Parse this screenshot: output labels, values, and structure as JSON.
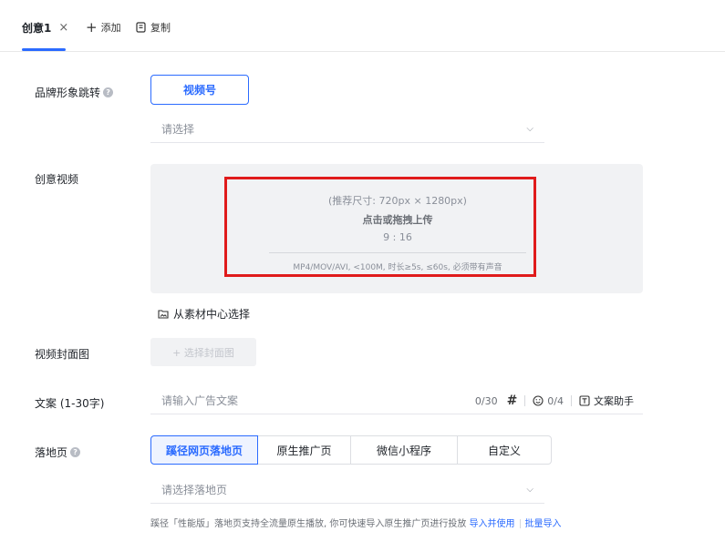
{
  "tabs": {
    "active_label": "创意1",
    "close_glyph": "×",
    "add_label": "添加",
    "copy_label": "复制"
  },
  "brand": {
    "label": "品牌形象跳转",
    "button": "视频号",
    "select_placeholder": "请选择"
  },
  "video": {
    "label": "创意视频",
    "size_hint": "(推荐尺寸: 720px × 1280px)",
    "click_hint": "点击或拖拽上传",
    "ratio": "9 : 16",
    "spec": "MP4/MOV/AVI, <100M, 时长≥5s, ≤60s, 必须带有声音",
    "material_link": "从素材中心选择"
  },
  "cover": {
    "label": "视频封面图",
    "button": "+ 选择封面图"
  },
  "copy": {
    "label": "文案 (1-30字)",
    "placeholder": "请输入广告文案",
    "count": "0/30",
    "hash": "#",
    "emoji_count": "0/4",
    "assistant": "文案助手"
  },
  "landing": {
    "label": "落地页",
    "segments": [
      "蹊径网页落地页",
      "原生推广页",
      "微信小程序",
      "自定义"
    ],
    "select_placeholder": "请选择落地页",
    "hint": "蹊径「性能版」落地页支持全流量原生播放, 你可快速导入原生推广页进行投放",
    "import_link": "导入并使用",
    "batch_link": "批量导入"
  },
  "colors": {
    "accent": "#2b6bff",
    "highlight_box": "#e01b1b"
  }
}
